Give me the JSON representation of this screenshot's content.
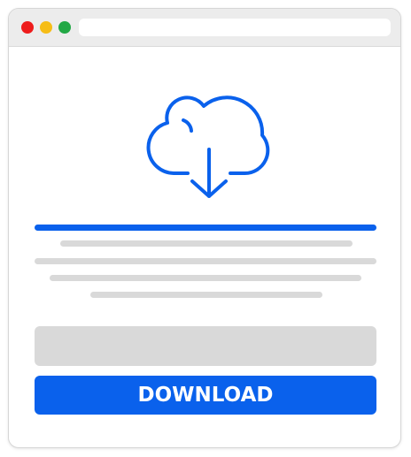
{
  "window": {
    "controls": [
      {
        "name": "close-dot",
        "color": "#ee1c1c"
      },
      {
        "name": "minimize-dot",
        "color": "#f6bd16"
      },
      {
        "name": "maximize-dot",
        "color": "#22a845"
      }
    ]
  },
  "content": {
    "icon": "cloud-download-icon",
    "progress_value": 1.0
  },
  "download_button": {
    "label": "DOWNLOAD"
  },
  "colors": {
    "accent": "#0a61ec",
    "placeholder": "#d9d9d9",
    "titlebar": "#ececec"
  }
}
